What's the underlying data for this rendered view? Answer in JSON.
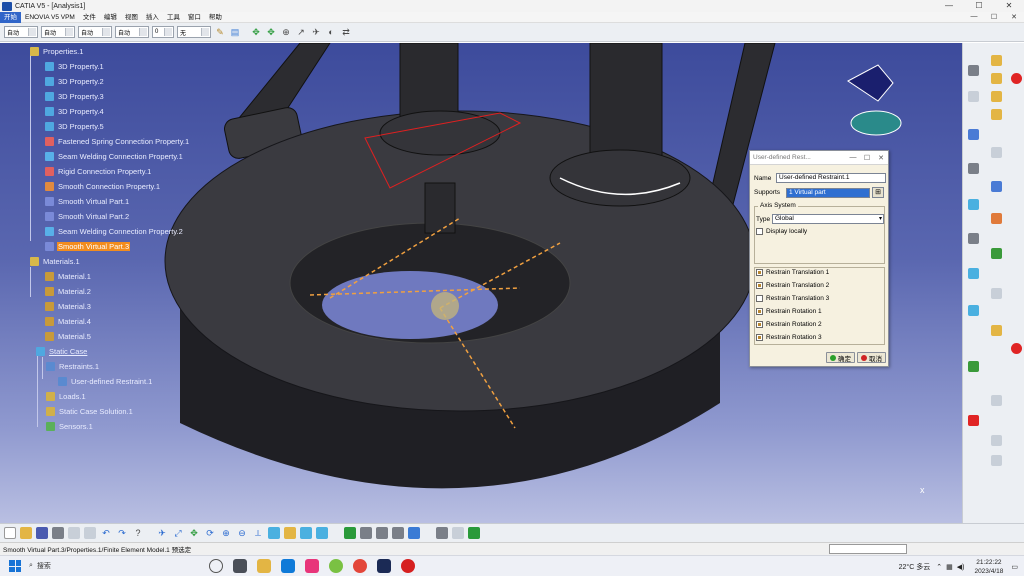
{
  "window": {
    "title": "CATIA V5 - [Analysis1]",
    "controls": [
      "—",
      "☐",
      "✕"
    ]
  },
  "menu": {
    "items": [
      "开始",
      "ENOVIA V5 VPM",
      "文件",
      "编辑",
      "视图",
      "插入",
      "工具",
      "窗口",
      "帮助"
    ],
    "active_index": 0
  },
  "toolbar_top": {
    "combos": [
      "自动",
      "自动",
      "自动",
      "自动",
      "0",
      "无"
    ]
  },
  "tree": {
    "nodes": [
      {
        "label": "Properties.1",
        "icon": "folder-icon"
      },
      {
        "label": "3D Property.1",
        "icon": "cube-icon"
      },
      {
        "label": "3D Property.2",
        "icon": "cube-icon"
      },
      {
        "label": "3D Property.3",
        "icon": "cube-icon"
      },
      {
        "label": "3D Property.4",
        "icon": "cube-icon"
      },
      {
        "label": "3D Property.5",
        "icon": "cube-icon"
      },
      {
        "label": "Fastened Spring Connection Property.1",
        "icon": "connection-icon"
      },
      {
        "label": "Seam Welding Connection Property.1",
        "icon": "weld-icon"
      },
      {
        "label": "Rigid Connection Property.1",
        "icon": "rigid-icon"
      },
      {
        "label": "Smooth Connection Property.1",
        "icon": "smooth-icon"
      },
      {
        "label": "Smooth Virtual Part.1",
        "icon": "virtual-part-icon"
      },
      {
        "label": "Smooth Virtual Part.2",
        "icon": "virtual-part-icon"
      },
      {
        "label": "Seam Welding Connection Property.2",
        "icon": "weld-icon"
      },
      {
        "label": "Smooth Virtual Part.3",
        "icon": "virtual-part-icon"
      },
      {
        "label": "Materials.1",
        "icon": "folder-icon"
      },
      {
        "label": "Material.1",
        "icon": "material-icon"
      },
      {
        "label": "Material.2",
        "icon": "material-icon"
      },
      {
        "label": "Material.3",
        "icon": "material-icon"
      },
      {
        "label": "Material.4",
        "icon": "material-icon"
      },
      {
        "label": "Material.5",
        "icon": "material-icon"
      },
      {
        "label": "Static Case",
        "icon": "static-case-icon"
      },
      {
        "label": "Restraints.1",
        "icon": "restraint-icon"
      },
      {
        "label": "User-defined Restraint.1",
        "icon": "user-restraint-icon"
      },
      {
        "label": "Loads.1",
        "icon": "load-icon"
      },
      {
        "label": "Static Case Solution.1",
        "icon": "solution-icon"
      },
      {
        "label": "Sensors.1",
        "icon": "sensor-icon"
      }
    ]
  },
  "dialog": {
    "title": "User-defined Rest...",
    "name_label": "Name",
    "name_value": "User-defined Restraint.1",
    "supports_label": "Supports",
    "supports_value": "1 Virtual part",
    "axis_frame_title": "Axis System",
    "type_label": "Type",
    "type_value": "Global",
    "display_locally": "Display locally",
    "restraints": [
      {
        "label": "Restrain Translation 1",
        "checked": true
      },
      {
        "label": "Restrain Translation 2",
        "checked": true
      },
      {
        "label": "Restrain Translation 3",
        "checked": false
      },
      {
        "label": "Restrain Rotation 1",
        "checked": true
      },
      {
        "label": "Restrain Rotation 2",
        "checked": true
      },
      {
        "label": "Restrain Rotation 3",
        "checked": true
      }
    ],
    "ok_label": "确定",
    "cancel_label": "取消"
  },
  "status": {
    "text": "Smooth Virtual Part.3/Properties.1/Finite Element Model.1 预选定"
  },
  "taskbar": {
    "search_label": "搜索",
    "temperature": "22°C 多云",
    "time": "21:22:22",
    "date": "2023/4/18"
  },
  "colors": {
    "highlight": "#f28c1e",
    "viewport_top": "#3d4b9c",
    "viewport_bottom": "#b9bfe2",
    "dialog_bg": "#f6f1e0"
  }
}
